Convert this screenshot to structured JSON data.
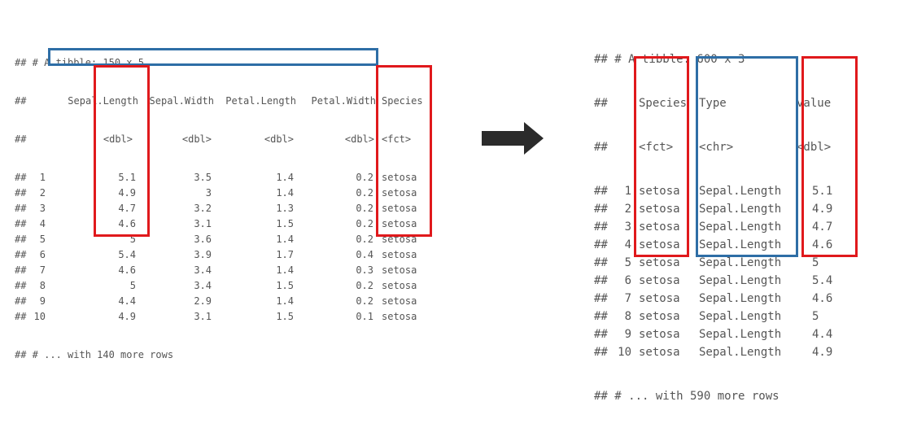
{
  "colors": {
    "highlight_red": "#e0191c",
    "highlight_blue": "#2e6ea6",
    "arrow": "#2b2b2b",
    "text": "#555555"
  },
  "left_table": {
    "prefix": "##",
    "title_line": "## # A tibble: 150 x 5",
    "columns": [
      "Sepal.Length",
      "Sepal.Width",
      "Petal.Length",
      "Petal.Width",
      "Species"
    ],
    "types": [
      "<dbl>",
      "<dbl>",
      "<dbl>",
      "<dbl>",
      "<fct>"
    ],
    "rows": [
      {
        "n": "1",
        "cells": [
          "5.1",
          "3.5",
          "1.4",
          "0.2",
          "setosa"
        ]
      },
      {
        "n": "2",
        "cells": [
          "4.9",
          "3",
          "1.4",
          "0.2",
          "setosa"
        ]
      },
      {
        "n": "3",
        "cells": [
          "4.7",
          "3.2",
          "1.3",
          "0.2",
          "setosa"
        ]
      },
      {
        "n": "4",
        "cells": [
          "4.6",
          "3.1",
          "1.5",
          "0.2",
          "setosa"
        ]
      },
      {
        "n": "5",
        "cells": [
          "5",
          "3.6",
          "1.4",
          "0.2",
          "setosa"
        ]
      },
      {
        "n": "6",
        "cells": [
          "5.4",
          "3.9",
          "1.7",
          "0.4",
          "setosa"
        ]
      },
      {
        "n": "7",
        "cells": [
          "4.6",
          "3.4",
          "1.4",
          "0.3",
          "setosa"
        ]
      },
      {
        "n": "8",
        "cells": [
          "5",
          "3.4",
          "1.5",
          "0.2",
          "setosa"
        ]
      },
      {
        "n": "9",
        "cells": [
          "4.4",
          "2.9",
          "1.4",
          "0.2",
          "setosa"
        ]
      },
      {
        "n": "10",
        "cells": [
          "4.9",
          "3.1",
          "1.5",
          "0.1",
          "setosa"
        ]
      }
    ],
    "footer": "## # ... with 140 more rows"
  },
  "right_table": {
    "prefix": "##",
    "title_line": "## # A tibble: 600 x 3",
    "columns": [
      "Species",
      "Type",
      "value"
    ],
    "types": [
      "<fct>",
      "<chr>",
      "<dbl>"
    ],
    "rows": [
      {
        "n": "1",
        "cells": [
          "setosa",
          "Sepal.Length",
          "5.1"
        ]
      },
      {
        "n": "2",
        "cells": [
          "setosa",
          "Sepal.Length",
          "4.9"
        ]
      },
      {
        "n": "3",
        "cells": [
          "setosa",
          "Sepal.Length",
          "4.7"
        ]
      },
      {
        "n": "4",
        "cells": [
          "setosa",
          "Sepal.Length",
          "4.6"
        ]
      },
      {
        "n": "5",
        "cells": [
          "setosa",
          "Sepal.Length",
          "5"
        ]
      },
      {
        "n": "6",
        "cells": [
          "setosa",
          "Sepal.Length",
          "5.4"
        ]
      },
      {
        "n": "7",
        "cells": [
          "setosa",
          "Sepal.Length",
          "4.6"
        ]
      },
      {
        "n": "8",
        "cells": [
          "setosa",
          "Sepal.Length",
          "5"
        ]
      },
      {
        "n": "9",
        "cells": [
          "setosa",
          "Sepal.Length",
          "4.4"
        ]
      },
      {
        "n": "10",
        "cells": [
          "setosa",
          "Sepal.Length",
          "4.9"
        ]
      }
    ],
    "footer": "## # ... with 590 more rows"
  }
}
